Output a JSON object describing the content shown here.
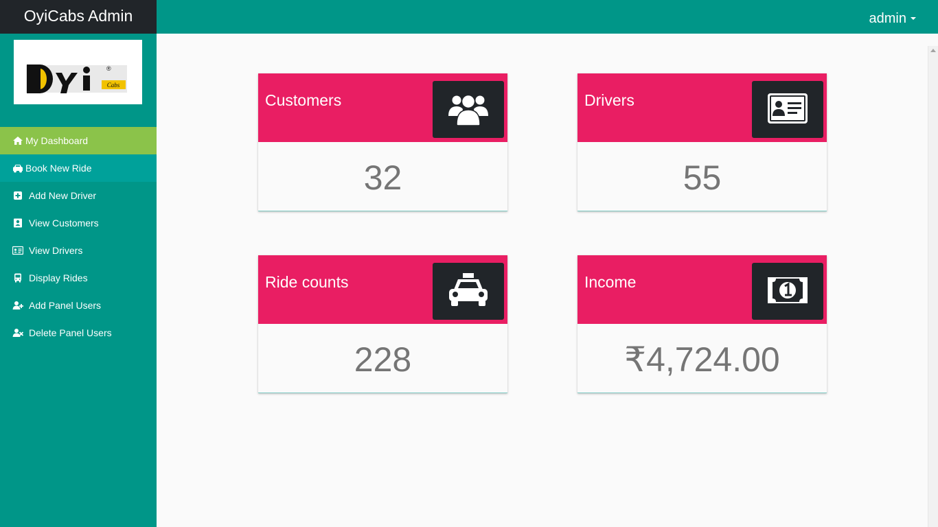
{
  "header": {
    "brand": "OyiCabs Admin",
    "user": "admin"
  },
  "sidebar": {
    "logo_text": "Oyi",
    "logo_sub": "Cabs",
    "items": [
      {
        "label": "My Dashboard",
        "icon": "home-icon",
        "state": "active"
      },
      {
        "label": "Book New Ride",
        "icon": "car-icon",
        "state": "hover"
      },
      {
        "label": "Add New Driver",
        "icon": "plus-square-icon"
      },
      {
        "label": "View Customers",
        "icon": "address-book-icon"
      },
      {
        "label": "View Drivers",
        "icon": "id-card-icon"
      },
      {
        "label": "Display Rides",
        "icon": "bus-icon"
      },
      {
        "label": "Add Panel Users",
        "icon": "user-plus-icon"
      },
      {
        "label": "Delete Panel Users",
        "icon": "user-times-icon"
      }
    ]
  },
  "cards": [
    {
      "title": "Customers",
      "value": "32",
      "icon": "users-icon"
    },
    {
      "title": "Drivers",
      "value": "55",
      "icon": "id-card-icon"
    },
    {
      "title": "Ride counts",
      "value": "228",
      "icon": "taxi-icon"
    },
    {
      "title": "Income",
      "value": "₹4,724.00",
      "icon": "money-bill-icon"
    }
  ],
  "colors": {
    "primary": "#009688",
    "brand_bg": "#212529",
    "active_item": "#8bc34a",
    "card_header": "#e91e63",
    "icon_box": "#212529",
    "value_text": "#757575"
  }
}
